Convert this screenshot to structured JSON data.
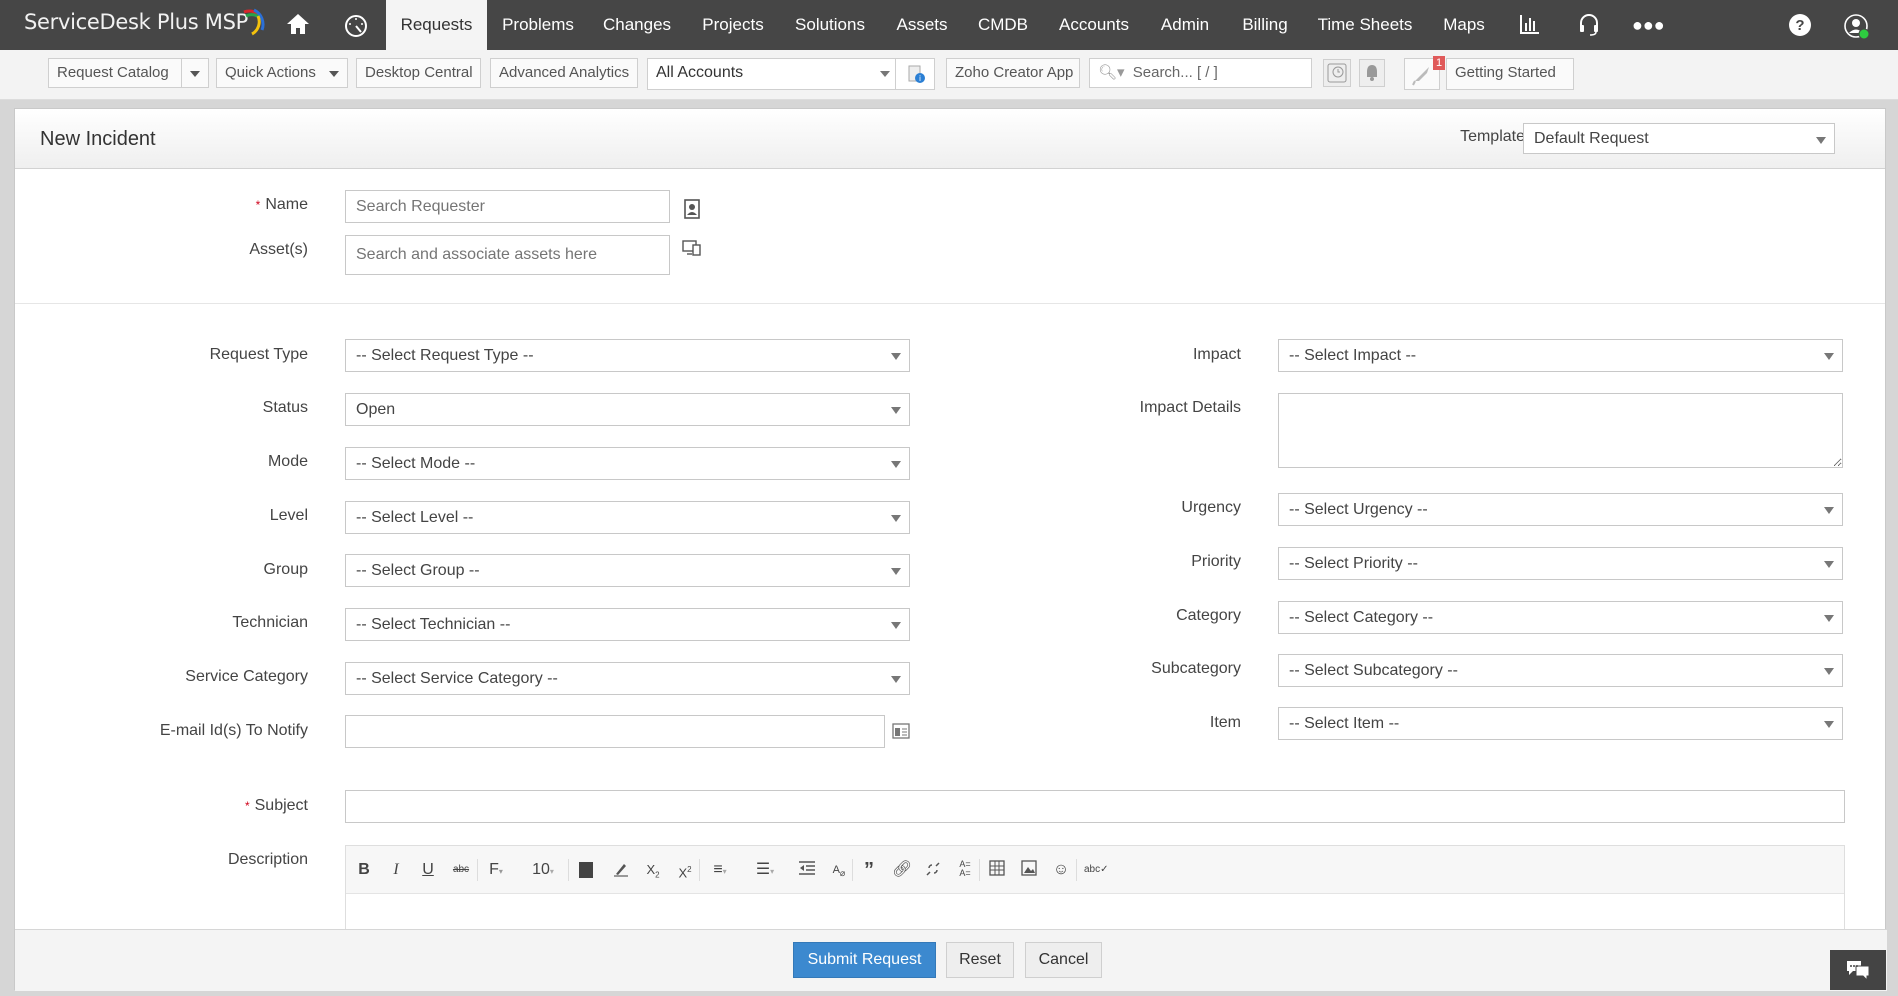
{
  "app": {
    "logo_text": "ServiceDesk Plus MSP",
    "brand_colors": {
      "nav_bg": "#464646",
      "primary_button": "#3c89cf",
      "required_star": "#d0021b",
      "presence_dot": "#2ecc40"
    }
  },
  "nav": {
    "icons": {
      "home": "home-icon",
      "dashboard": "dashboard-icon",
      "reports": "reports-icon",
      "support": "headset-icon",
      "more": "more-icon",
      "help": "help-icon",
      "profile": "profile-icon"
    },
    "tabs": [
      {
        "label": "Requests",
        "active": true
      },
      {
        "label": "Problems"
      },
      {
        "label": "Changes"
      },
      {
        "label": "Projects"
      },
      {
        "label": "Solutions"
      },
      {
        "label": "Assets"
      },
      {
        "label": "CMDB"
      },
      {
        "label": "Accounts"
      },
      {
        "label": "Admin"
      },
      {
        "label": "Billing"
      },
      {
        "label": "Time Sheets"
      },
      {
        "label": "Maps"
      }
    ]
  },
  "toolbar": {
    "request_catalog": "Request Catalog",
    "quick_actions": "Quick Actions",
    "desktop_central": "Desktop Central",
    "advanced_analytics": "Advanced Analytics",
    "account_select": "All Accounts",
    "zoho_creator": "Zoho Creator App",
    "search_placeholder": "Search... [ / ]",
    "notification_badge": "1",
    "getting_started": "Getting Started"
  },
  "form": {
    "title": "New Incident",
    "template_label": "Template",
    "template_value": "Default Request",
    "name_label": "Name",
    "name_placeholder": "Search Requester",
    "assets_label": "Asset(s)",
    "assets_placeholder": "Search and associate assets here",
    "left_fields": [
      {
        "label": "Request Type",
        "value": "-- Select Request Type --"
      },
      {
        "label": "Status",
        "value": "Open"
      },
      {
        "label": "Mode",
        "value": "-- Select Mode --"
      },
      {
        "label": "Level",
        "value": "-- Select Level --"
      },
      {
        "label": "Group",
        "value": "-- Select Group --"
      },
      {
        "label": "Technician",
        "value": "-- Select Technician --"
      },
      {
        "label": "Service Category",
        "value": "-- Select Service Category --"
      }
    ],
    "email_label": "E-mail Id(s) To Notify",
    "email_value": "",
    "impact_label": "Impact",
    "impact_value": "-- Select Impact --",
    "impact_details_label": "Impact Details",
    "impact_details_value": "",
    "right_fields": [
      {
        "label": "Urgency",
        "value": "-- Select Urgency --"
      },
      {
        "label": "Priority",
        "value": "-- Select Priority --"
      },
      {
        "label": "Category",
        "value": "-- Select Category --"
      },
      {
        "label": "Subcategory",
        "value": "-- Select Subcategory --"
      },
      {
        "label": "Item",
        "value": "-- Select Item --"
      }
    ],
    "subject_label": "Subject",
    "subject_value": "",
    "description_label": "Description",
    "font_size": "10",
    "editor_tools": [
      "bold",
      "italic",
      "underline",
      "strikethrough",
      "font-family",
      "font-size",
      "text-color",
      "highlight",
      "subscript",
      "superscript",
      "align",
      "list",
      "indent",
      "clear-format",
      "blockquote",
      "link",
      "unlink",
      "line-height",
      "table",
      "image",
      "emoji",
      "spellcheck"
    ]
  },
  "footer": {
    "submit": "Submit Request",
    "reset": "Reset",
    "cancel": "Cancel"
  }
}
